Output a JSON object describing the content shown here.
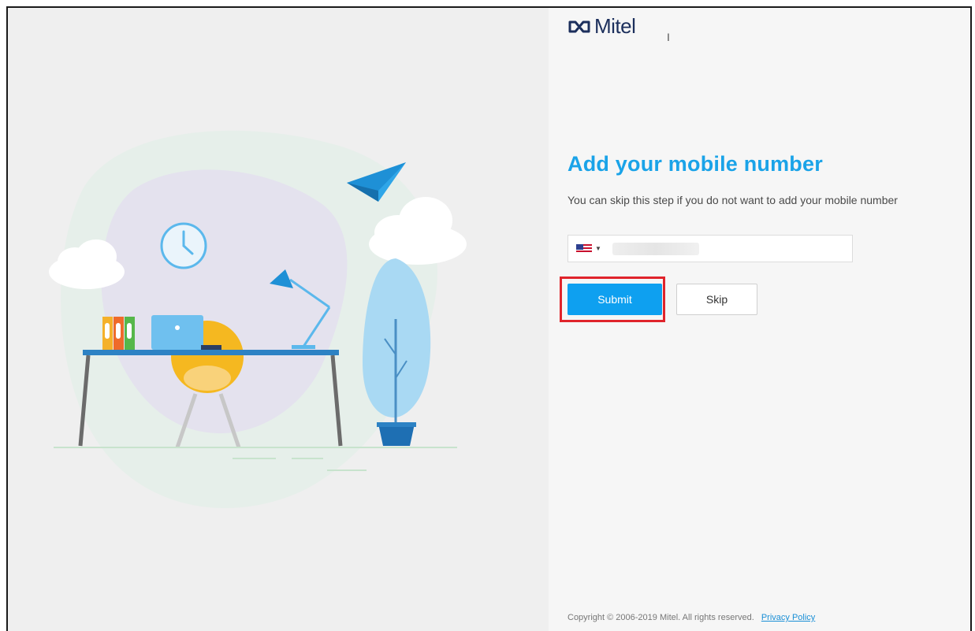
{
  "brand": {
    "logo_icon": "mitel-loop-icon",
    "name": "Mitel",
    "color": "#1c2f5c"
  },
  "form": {
    "title": "Add your mobile number",
    "subtitle": "You can skip this step if you do not want to add your mobile number",
    "phone": {
      "country_flag": "us-flag-icon",
      "value": ""
    },
    "submit_label": "Submit",
    "skip_label": "Skip"
  },
  "footer": {
    "copyright": "Copyright © 2006-2019 Mitel. All rights reserved.",
    "privacy_link": "Privacy Policy"
  },
  "colors": {
    "accent": "#1aa3e8",
    "submit_bg": "#0ea0f0",
    "highlight": "#e0242b"
  }
}
